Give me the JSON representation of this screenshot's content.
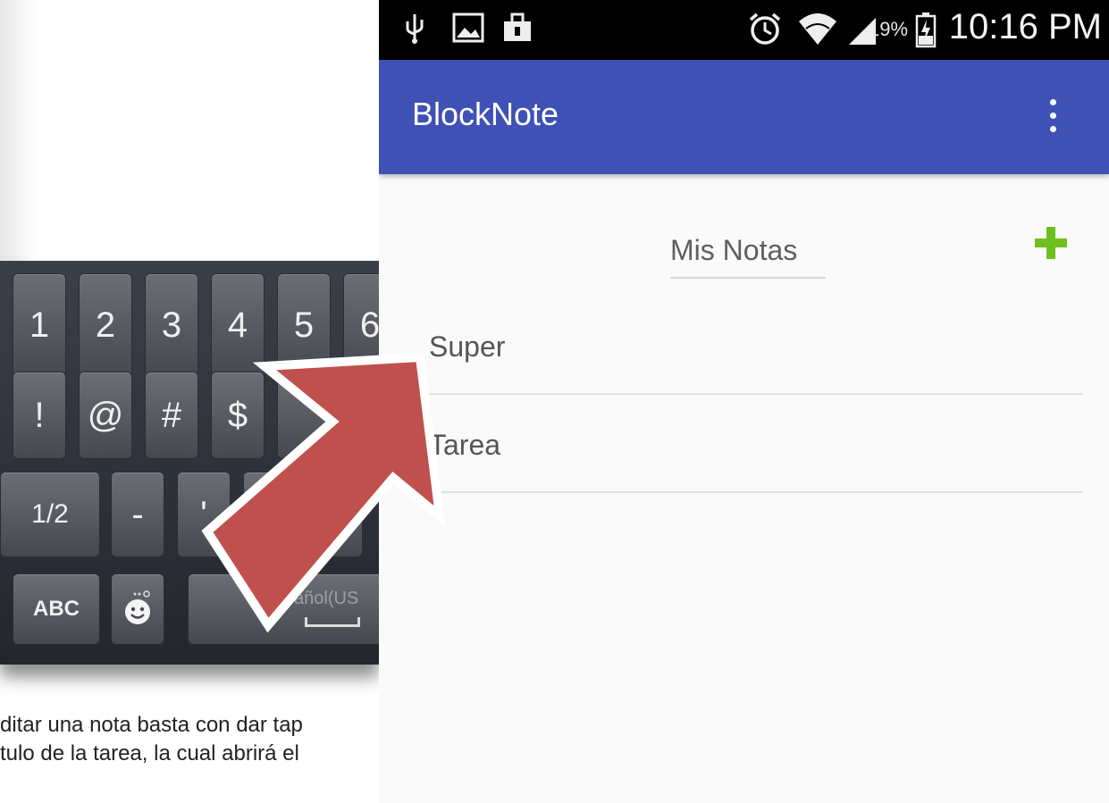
{
  "document": {
    "text_lines": [
      "ditar una nota basta con dar tap",
      "tulo de la tarea, la cual abrirá el"
    ]
  },
  "keyboard": {
    "row1": [
      "1",
      "2",
      "3",
      "4",
      "5",
      "6"
    ],
    "row2": [
      "!",
      "@",
      "#",
      "$"
    ],
    "row3": [
      "1/2",
      "-",
      "'"
    ],
    "row4": {
      "mode_key": "ABC",
      "emoji_icon": "smiley-face-icon",
      "space_label": "◂ Español(US"
    }
  },
  "status_bar": {
    "time": "10:16 PM",
    "battery_percent": "19%",
    "left_icons": [
      "usb-icon",
      "image-icon",
      "briefcase-icon"
    ],
    "right_icons": [
      "alarm-icon",
      "wifi-icon",
      "signal-icon",
      "battery-icon"
    ]
  },
  "app_bar": {
    "title": "BlockNote",
    "color": "#3f51b5",
    "menu_icon": "overflow-menu-icon"
  },
  "main": {
    "heading": "Mis Notas",
    "add_icon": "plus-icon",
    "add_color": "#6fc01b",
    "notes": [
      {
        "label": "Super"
      },
      {
        "label": "Tarea"
      }
    ]
  },
  "annotation": {
    "arrow_color": "#c0504d",
    "arrow_outline": "#ffffff"
  }
}
